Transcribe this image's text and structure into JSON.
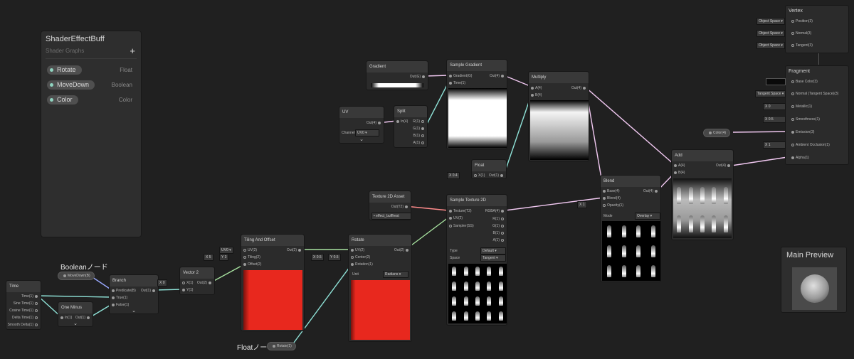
{
  "blackboard": {
    "title": "ShaderEffectBuff",
    "subtitle": "Shader Graphs",
    "add_icon": "plus-icon",
    "properties": [
      {
        "name": "Rotate",
        "type": "Float"
      },
      {
        "name": "MoveDown",
        "type": "Boolean"
      },
      {
        "name": "Color",
        "type": "Color"
      }
    ]
  },
  "annotations": {
    "boolean_node": "Booleanノード",
    "float_node": "Floatノード"
  },
  "time": {
    "title": "Time",
    "ports": [
      "Time(1)",
      "Sine Time(1)",
      "Cosine Time(1)",
      "Delta Time(1)",
      "Smooth Delta(1)"
    ]
  },
  "movedown_prop": {
    "label": "MoveDown(B)"
  },
  "rotate_prop": {
    "label": "Rotate(1)"
  },
  "color_prop": {
    "label": "Color(4)"
  },
  "one_minus": {
    "title": "One Minus",
    "in": "In(1)",
    "out": "Out(1)"
  },
  "branch": {
    "title": "Branch",
    "inputs": [
      "Predicate(B)",
      "True(1)",
      "False(1)"
    ],
    "out": "Out(1)"
  },
  "vector2": {
    "title": "Vector 2",
    "inputs": [
      "X(1)",
      "Y(1)"
    ],
    "out": "Out(2)",
    "x_label": "X",
    "x_value": "0"
  },
  "tiling": {
    "title": "Tiling And Offset",
    "inputs": [
      "UV(2)",
      "Tiling(2)",
      "Offset(2)"
    ],
    "out": "Out(2)",
    "uv_value": "UV0",
    "x_label": "X",
    "x_value": "5",
    "y_label": "Y",
    "y_value": "3"
  },
  "rotate_node": {
    "title": "Rotate",
    "inputs": [
      "UV(2)",
      "Center(2)",
      "Rotation(1)"
    ],
    "out": "Out(2)",
    "unit_label": "Unit",
    "unit_value": "Radians",
    "x_label": "X",
    "x_value": "0.5",
    "y_label": "Y",
    "y_value": "0.5"
  },
  "gradient": {
    "title": "Gradient",
    "out": "Out(G)"
  },
  "uv": {
    "title": "UV",
    "out": "Out(4)",
    "channel_label": "Channel",
    "channel_value": "UV0"
  },
  "split": {
    "title": "Split",
    "in": "In(4)",
    "outs": [
      "R(1)",
      "G(1)",
      "B(1)",
      "A(1)"
    ]
  },
  "sample_gradient": {
    "title": "Sample Gradient",
    "inputs": [
      "Gradient(G)",
      "Time(1)"
    ],
    "out": "Out(4)"
  },
  "float_node": {
    "title": "Float",
    "in": "X(1)",
    "out": "Out(1)",
    "x_label": "X",
    "x_value": "0.4"
  },
  "multiply": {
    "title": "Multiply",
    "inputs": [
      "A(4)",
      "B(4)"
    ],
    "out": "Out(4)"
  },
  "tex2d_asset": {
    "title": "Texture 2D Asset",
    "out": "Out(T2)",
    "asset": "effect_buffhest"
  },
  "sample_tex": {
    "title": "Sample Texture 2D",
    "inputs": [
      "Texture(T2)",
      "UV(2)",
      "Sampler(SS)"
    ],
    "outs": [
      "RGBA(4)",
      "R(1)",
      "G(1)",
      "B(1)",
      "A(1)"
    ],
    "type_label": "Type",
    "type_value": "Default",
    "space_label": "Space",
    "space_value": "Tangent"
  },
  "blend": {
    "title": "Blend",
    "inputs": [
      "Base(4)",
      "Blend(4)",
      "Opacity(1)"
    ],
    "out": "Out(4)",
    "mode_label": "Mode",
    "mode_value": "Overlay",
    "x_label": "X",
    "x_value": "1"
  },
  "add": {
    "title": "Add",
    "inputs": [
      "A(4)",
      "B(4)"
    ],
    "out": "Out(4)"
  },
  "vertex": {
    "title": "Vertex",
    "ports": [
      {
        "field": "Object Space",
        "label": "Position(3)"
      },
      {
        "field": "Object Space",
        "label": "Normal(3)"
      },
      {
        "field": "Object Space",
        "label": "Tangent(3)"
      }
    ]
  },
  "fragment": {
    "title": "Fragment",
    "ports": [
      {
        "field": "",
        "label": "Base Color(3)"
      },
      {
        "field": "Tangent Space",
        "label": "Normal (Tangent Space)(3)"
      },
      {
        "field": "X  0",
        "label": "Metallic(1)"
      },
      {
        "field": "X  0.5",
        "label": "Smoothness(1)"
      },
      {
        "field": "",
        "label": "Emission(3)"
      },
      {
        "field": "X  1",
        "label": "Ambient Occlusion(1)"
      },
      {
        "field": "",
        "label": "Alpha(1)"
      }
    ]
  },
  "main_preview": {
    "title": "Main Preview"
  },
  "colors": {
    "canvas": "#202020",
    "red_preview": "#e8281e",
    "wire_float": "#8fe3d8",
    "wire_vec2": "#a8e3a0",
    "wire_vec4": "#f2c9f2",
    "wire_texture": "#ff8b8b",
    "wire_bool": "#9aa9ff"
  }
}
